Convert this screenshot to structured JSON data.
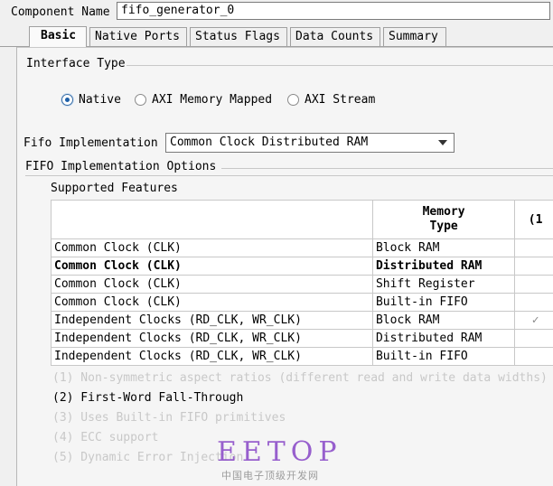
{
  "component": {
    "label": "Component Name",
    "value": "fifo_generator_0"
  },
  "tabs": [
    {
      "label": "Basic",
      "active": true
    },
    {
      "label": "Native Ports",
      "active": false
    },
    {
      "label": "Status Flags",
      "active": false
    },
    {
      "label": "Data Counts",
      "active": false
    },
    {
      "label": "Summary",
      "active": false
    }
  ],
  "interface": {
    "title": "Interface Type",
    "options": [
      {
        "label": "Native",
        "selected": true
      },
      {
        "label": "AXI Memory Mapped",
        "selected": false
      },
      {
        "label": "AXI Stream",
        "selected": false
      }
    ]
  },
  "fifo_impl": {
    "label": "Fifo Implementation",
    "value": "Common Clock Distributed RAM"
  },
  "options_section": {
    "title": "FIFO Implementation Options",
    "supported": "Supported Features"
  },
  "table": {
    "headers": [
      "",
      "Memory\nType",
      "(1"
    ],
    "rows": [
      {
        "clock": "Common Clock (CLK)",
        "memory": "Block RAM",
        "check": "",
        "bold": false
      },
      {
        "clock": "Common Clock (CLK)",
        "memory": "Distributed RAM",
        "check": "",
        "bold": true
      },
      {
        "clock": "Common Clock (CLK)",
        "memory": "Shift Register",
        "check": "",
        "bold": false
      },
      {
        "clock": "Common Clock (CLK)",
        "memory": "Built-in FIFO",
        "check": "",
        "bold": false
      },
      {
        "clock": "Independent Clocks (RD_CLK, WR_CLK)",
        "memory": "Block RAM",
        "check": "✓",
        "bold": false
      },
      {
        "clock": "Independent Clocks (RD_CLK, WR_CLK)",
        "memory": "Distributed RAM",
        "check": "",
        "bold": false
      },
      {
        "clock": "Independent Clocks (RD_CLK, WR_CLK)",
        "memory": "Built-in FIFO",
        "check": "",
        "bold": false
      }
    ]
  },
  "notes": [
    {
      "text": "(1) Non-symmetric aspect ratios (different read and write data widths)",
      "active": false
    },
    {
      "text": "(2) First-Word Fall-Through",
      "active": true
    },
    {
      "text": "(3) Uses Built-in FIFO primitives",
      "active": false
    },
    {
      "text": "(4) ECC support",
      "active": false
    },
    {
      "text": "(5) Dynamic Error Injection",
      "active": false
    }
  ],
  "watermark": {
    "logo": "EETOP",
    "subtitle": "中国电子顶级开发网"
  }
}
